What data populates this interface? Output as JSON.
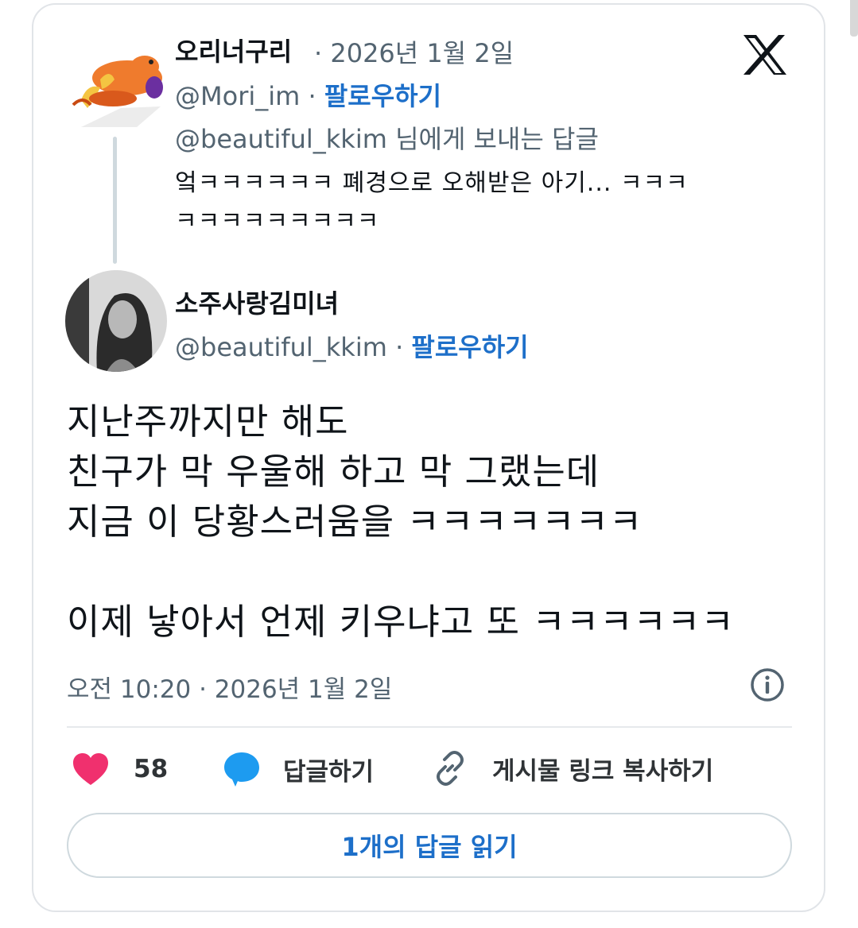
{
  "reply": {
    "display_name": "오리너구리",
    "date": "· 2026년 1월 2일",
    "handle": "@Mori_im",
    "separator": " · ",
    "follow_label": "팔로우하기",
    "replying_to": "@beautiful_kkim 님에게 보내는 답글",
    "text_line1": "엌ㅋㅋㅋㅋㅋㅋ 폐경으로 오해받은 아기... ㅋㅋㅋ",
    "text_line2": "ㅋㅋㅋㅋㅋㅋㅋㅋㅋ"
  },
  "main_post": {
    "display_name": "소주사랑김미녀",
    "handle": "@beautiful_kkim",
    "separator": " · ",
    "follow_label": "팔로우하기",
    "line1": "지난주까지만 해도",
    "line2": "친구가 막 우울해 하고 막 그랬는데",
    "line3": "지금 이 당황스러움을 ㅋㅋㅋㅋㅋㅋㅋ",
    "line4": "이제 낳아서 언제 키우냐고 또 ㅋㅋㅋㅋㅋㅋ",
    "timestamp": "오전 10:20 · 2026년 1월 2일"
  },
  "actions": {
    "like_count": "58",
    "reply_label": "답글하기",
    "copy_link_label": "게시물 링크 복사하기"
  },
  "read_replies_label": "1개의 답글 읽기",
  "colors": {
    "accent": "#1d6fc9",
    "like": "#f0306e",
    "reply_icon": "#1d9bf0",
    "muted": "#536471"
  },
  "icons": {
    "platform": "x-logo-icon",
    "info": "info-icon",
    "like": "heart-icon",
    "reply": "speech-bubble-icon",
    "link": "link-icon"
  }
}
